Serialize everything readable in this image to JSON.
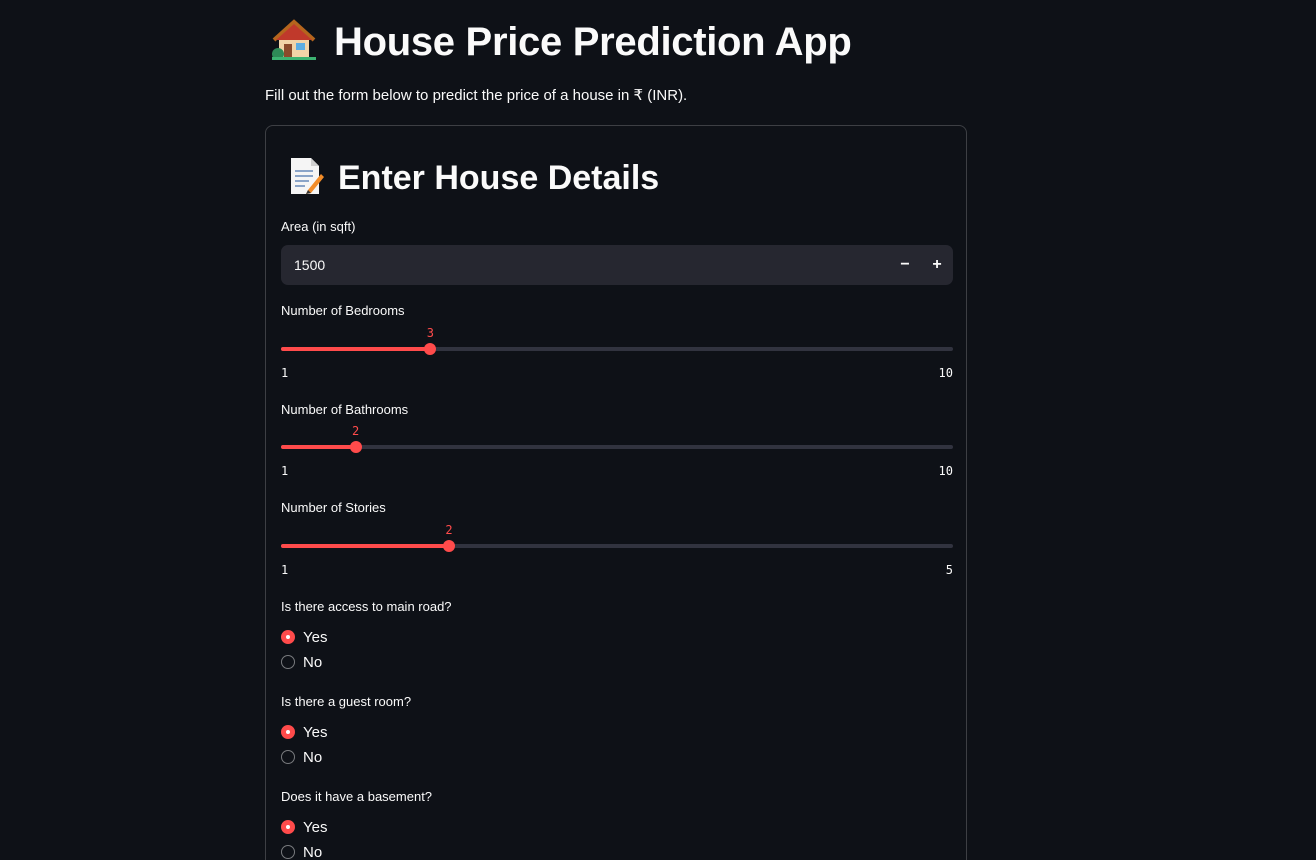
{
  "header": {
    "title": "House Price Prediction App",
    "subtitle": "Fill out the form below to predict the price of a house in ₹ (INR)."
  },
  "form": {
    "heading": "Enter House Details",
    "area": {
      "label": "Area (in sqft)",
      "value": "1500",
      "minus": "−",
      "plus": "+"
    },
    "bedrooms": {
      "label": "Number of Bedrooms",
      "value": 3,
      "min": 1,
      "max": 10
    },
    "bathrooms": {
      "label": "Number of Bathrooms",
      "value": 2,
      "min": 1,
      "max": 10
    },
    "stories": {
      "label": "Number of Stories",
      "value": 2,
      "min": 1,
      "max": 5
    },
    "mainroad": {
      "label": "Is there access to main road?",
      "options": [
        "Yes",
        "No"
      ],
      "selected": "Yes"
    },
    "guestroom": {
      "label": "Is there a guest room?",
      "options": [
        "Yes",
        "No"
      ],
      "selected": "Yes"
    },
    "basement": {
      "label": "Does it have a basement?",
      "options": [
        "Yes",
        "No"
      ],
      "selected": "Yes"
    }
  },
  "colors": {
    "accent": "#ff4b4b",
    "background": "#0e1117",
    "input_bg": "#262730"
  },
  "icons": {
    "title": "house-emoji-icon",
    "heading": "memo-emoji-icon"
  }
}
